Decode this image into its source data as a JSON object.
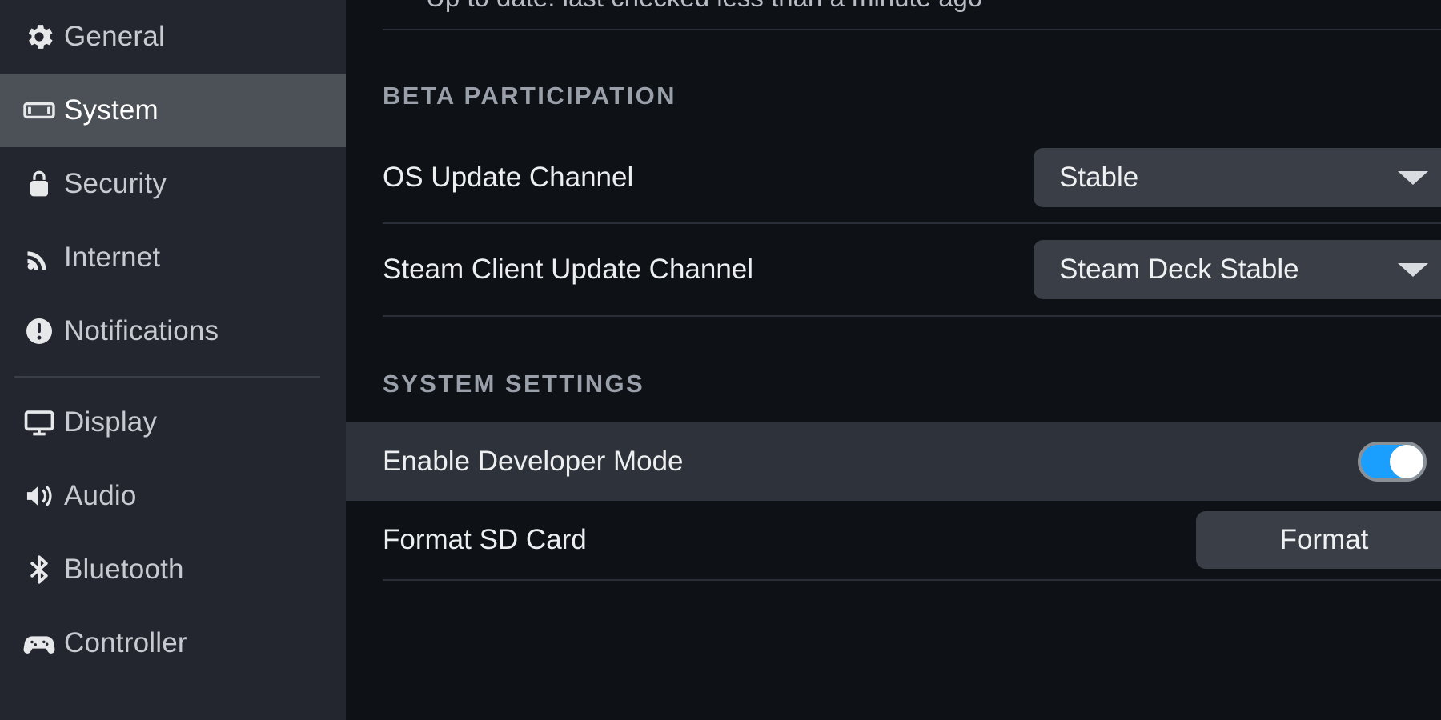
{
  "sidebar": {
    "items": [
      {
        "label": "General",
        "icon": "gear-icon"
      },
      {
        "label": "System",
        "icon": "handheld-device-icon",
        "selected": true
      },
      {
        "label": "Security",
        "icon": "lock-icon"
      },
      {
        "label": "Internet",
        "icon": "wifi-icon"
      },
      {
        "label": "Notifications",
        "icon": "alert-circle-icon"
      },
      {
        "label": "Display",
        "icon": "monitor-icon"
      },
      {
        "label": "Audio",
        "icon": "speaker-icon"
      },
      {
        "label": "Bluetooth",
        "icon": "bluetooth-icon"
      },
      {
        "label": "Controller",
        "icon": "gamepad-icon"
      }
    ]
  },
  "content": {
    "update_status": "Up to date: last checked less than a minute ago",
    "beta_section": {
      "title": "BETA PARTICIPATION",
      "rows": [
        {
          "label": "OS Update Channel",
          "value": "Stable",
          "control": "dropdown"
        },
        {
          "label": "Steam Client Update Channel",
          "value": "Steam Deck Stable",
          "control": "dropdown"
        }
      ]
    },
    "system_section": {
      "title": "SYSTEM SETTINGS",
      "rows": [
        {
          "label": "Enable Developer Mode",
          "control": "toggle",
          "toggle_on": true,
          "highlighted": true
        },
        {
          "label": "Format SD Card",
          "control": "button",
          "button_label": "Format",
          "highlighted": false
        }
      ]
    }
  },
  "colors": {
    "sidebar_bg": "#23262e",
    "sidebar_selected": "#4c5057",
    "content_bg": "#0e1116",
    "row_highlight": "#2e323a",
    "control_bg": "#3a3e46",
    "toggle_on": "#1a9fff",
    "toggle_knob": "#ffffff",
    "text_primary": "#eceef0",
    "section_header": "#9aa0a9"
  }
}
